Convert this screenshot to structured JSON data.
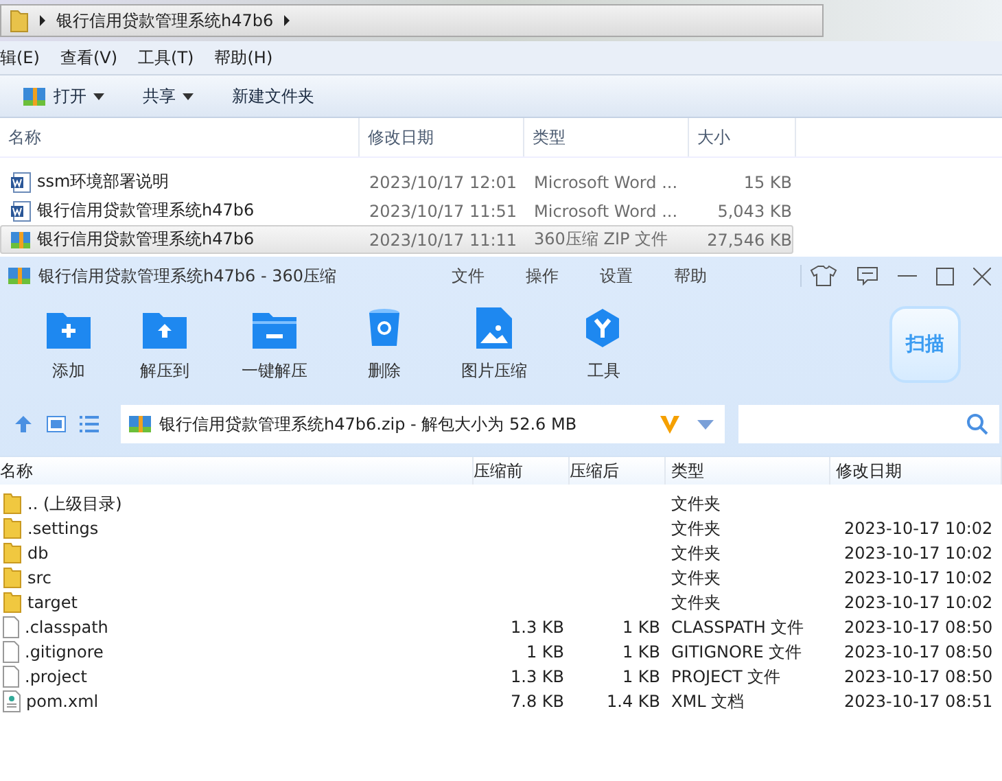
{
  "explorer": {
    "breadcrumb": "银行信用贷款管理系统h47b6",
    "menu": [
      "辑(E)",
      "查看(V)",
      "工具(T)",
      "帮助(H)"
    ],
    "toolbar": [
      {
        "label": "打开",
        "kind": "open"
      },
      {
        "label": "共享",
        "kind": "dropdown"
      },
      {
        "label": "新建文件夹",
        "kind": "plain"
      }
    ],
    "columns": [
      "名称",
      "修改日期",
      "类型",
      "大小"
    ],
    "rows": [
      {
        "name": "ssm环境部署说明",
        "date": "2023/10/17 12:01",
        "type": "Microsoft Word ...",
        "size": "15 KB",
        "kind": "word",
        "selected": false
      },
      {
        "name": "银行信用贷款管理系统h47b6",
        "date": "2023/10/17 11:51",
        "type": "Microsoft Word ...",
        "size": "5,043 KB",
        "kind": "word",
        "selected": false
      },
      {
        "name": "银行信用贷款管理系统h47b6",
        "date": "2023/10/17 11:11",
        "type": "360压缩 ZIP 文件",
        "size": "27,546 KB",
        "kind": "zip",
        "selected": true
      }
    ]
  },
  "archiver": {
    "title": "银行信用贷款管理系统h47b6 - 360压缩",
    "menu": [
      "文件",
      "操作",
      "设置",
      "帮助"
    ],
    "tools": [
      {
        "label": "添加",
        "kind": "add"
      },
      {
        "label": "解压到",
        "kind": "extract"
      },
      {
        "label": "一键解压",
        "kind": "quick"
      },
      {
        "label": "删除",
        "kind": "delete"
      },
      {
        "label": "图片压缩",
        "kind": "image"
      },
      {
        "label": "工具",
        "kind": "tools"
      }
    ],
    "scan": "扫描",
    "path": "银行信用贷款管理系统h47b6.zip - 解包大小为 52.6 MB",
    "columns": [
      "名称",
      "压缩前",
      "压缩后",
      "类型",
      "修改日期"
    ],
    "rows": [
      {
        "name": ".. (上级目录)",
        "kind": "folder",
        "type": "文件夹"
      },
      {
        "name": ".settings",
        "kind": "folder",
        "type": "文件夹",
        "date": "2023-10-17 10:02"
      },
      {
        "name": "db",
        "kind": "folder",
        "type": "文件夹",
        "date": "2023-10-17 10:02"
      },
      {
        "name": "src",
        "kind": "folder",
        "type": "文件夹",
        "date": "2023-10-17 10:02"
      },
      {
        "name": "target",
        "kind": "folder",
        "type": "文件夹",
        "date": "2023-10-17 10:02"
      },
      {
        "name": ".classpath",
        "kind": "file",
        "before": "1.3 KB",
        "after": "1 KB",
        "type": "CLASSPATH 文件",
        "date": "2023-10-17 08:50"
      },
      {
        "name": ".gitignore",
        "kind": "file",
        "before": "1 KB",
        "after": "1 KB",
        "type": "GITIGNORE 文件",
        "date": "2023-10-17 08:50"
      },
      {
        "name": ".project",
        "kind": "file",
        "before": "1.3 KB",
        "after": "1 KB",
        "type": "PROJECT 文件",
        "date": "2023-10-17 08:50"
      },
      {
        "name": "pom.xml",
        "kind": "xml",
        "before": "7.8 KB",
        "after": "1.4 KB",
        "type": "XML 文档",
        "date": "2023-10-17 08:51"
      }
    ]
  }
}
